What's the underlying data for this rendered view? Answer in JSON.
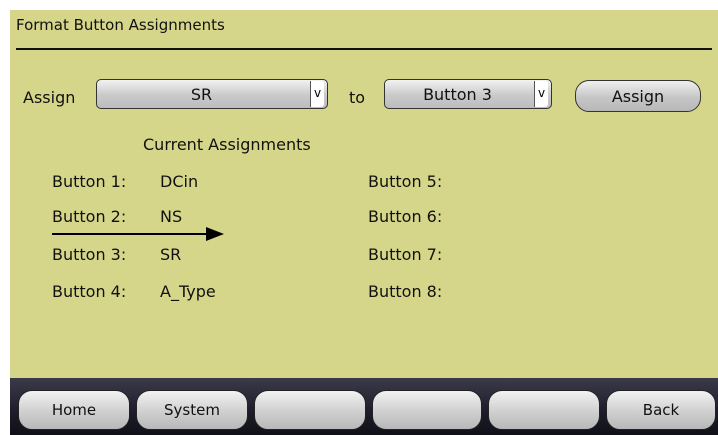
{
  "header": {
    "title": "Format Button Assignments"
  },
  "assign_row": {
    "assign_label": "Assign",
    "source_value": "SR",
    "to_label": "to",
    "target_value": "Button 3",
    "assign_button": "Assign",
    "dropdown_arrow": "v"
  },
  "current": {
    "title": "Current Assignments",
    "left": [
      {
        "label": "Button 1:",
        "value": "DCin"
      },
      {
        "label": "Button 2:",
        "value": "NS"
      },
      {
        "label": "Button 3:",
        "value": "SR"
      },
      {
        "label": "Button 4:",
        "value": "A_Type"
      }
    ],
    "right": [
      {
        "label": "Button 5:",
        "value": ""
      },
      {
        "label": "Button 6:",
        "value": ""
      },
      {
        "label": "Button 7:",
        "value": ""
      },
      {
        "label": "Button 8:",
        "value": ""
      }
    ]
  },
  "nav": [
    "Home",
    "System",
    "",
    "",
    "",
    "Back"
  ]
}
